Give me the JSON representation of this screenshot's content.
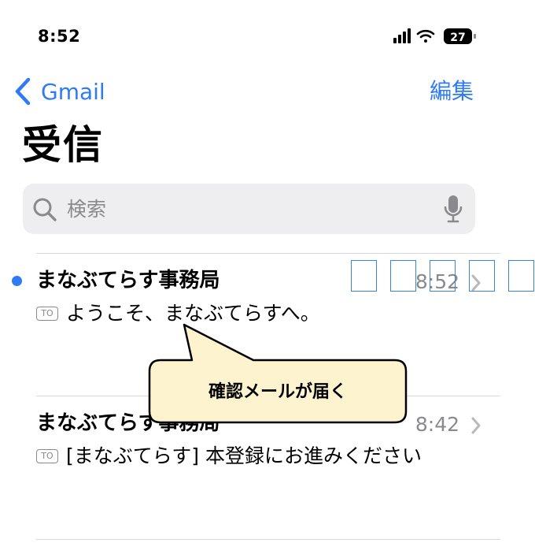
{
  "status_bar": {
    "time": "8:52",
    "battery": "27",
    "icons": [
      "cellular-signal-icon",
      "wifi-icon",
      "battery-icon"
    ]
  },
  "nav": {
    "back_label": "Gmail",
    "edit_label": "編集"
  },
  "page_title": "受信",
  "search": {
    "placeholder": "検索"
  },
  "mails": [
    {
      "sender": "まなぶてらす事務局",
      "time": "8:52",
      "badge": "TO",
      "subject": "ようこそ、まなぶてらすへ。",
      "unread": true
    },
    {
      "sender": "まなぶてらす事務局",
      "time": "8:42",
      "badge": "TO",
      "subject": "[まなぶてらす] 本登録にお進みください",
      "unread": false
    }
  ],
  "callout": {
    "text": "確認メールが届く"
  },
  "colors": {
    "accent": "#2f7bf5",
    "secondary_text": "#8a8a8e",
    "search_bg": "#eeeef0",
    "callout_bg": "#fdf3cf"
  }
}
